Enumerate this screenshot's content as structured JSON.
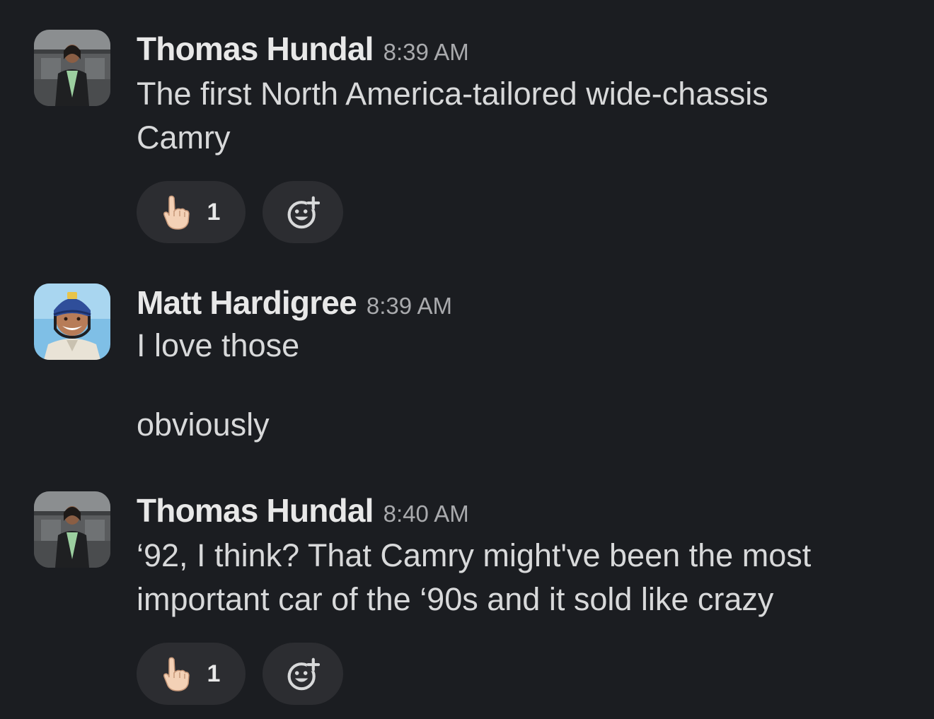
{
  "messages": [
    {
      "author": "Thomas Hundal",
      "time": "8:39 AM",
      "text": "The first North America-tailored wide-chassis\nCamry",
      "reaction": {
        "emoji": "point-up-emoji",
        "count": "1"
      }
    },
    {
      "author": "Matt Hardigree",
      "time": "8:39 AM",
      "text": "I love those\n\nobviously"
    },
    {
      "author": "Thomas Hundal",
      "time": "8:40 AM",
      "text": "‘92, I think? That Camry might've been the most\nimportant car of the ‘90s and it sold like crazy",
      "reaction": {
        "emoji": "point-up-emoji",
        "count": "1"
      }
    }
  ],
  "icons": {
    "add_reaction": "add-reaction-icon"
  },
  "colors": {
    "background": "#1b1d21",
    "pill": "#2c2d31",
    "name": "#e8e8e8",
    "time": "#a9aaad",
    "text": "#d8d9da"
  }
}
